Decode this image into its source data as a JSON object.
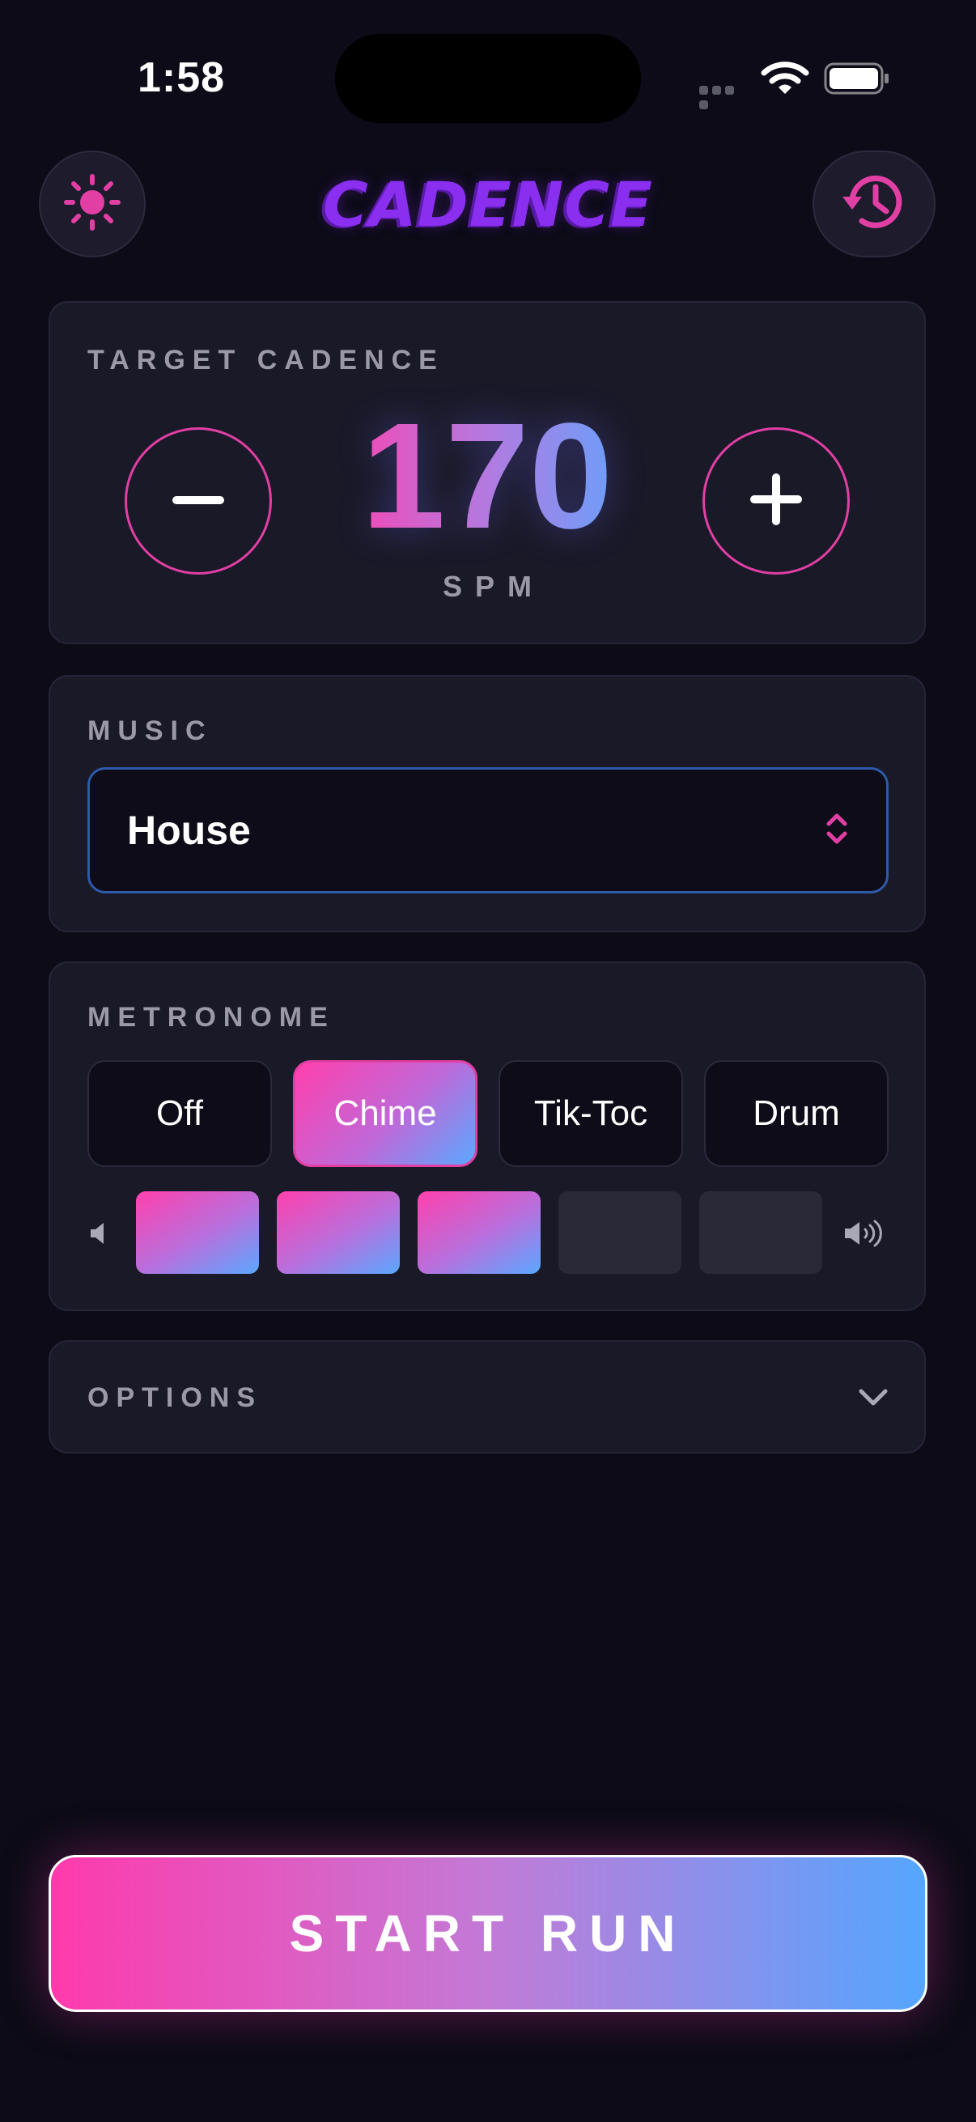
{
  "status_bar": {
    "time": "1:58"
  },
  "header": {
    "logo_text": "CADENCE",
    "theme_icon": "sun-icon",
    "history_icon": "history-icon"
  },
  "target_cadence": {
    "label": "TARGET CADENCE",
    "value": "170",
    "unit": "SPM",
    "decrement_icon": "minus-icon",
    "increment_icon": "plus-icon"
  },
  "music": {
    "label": "MUSIC",
    "selected": "House"
  },
  "metronome": {
    "label": "METRONOME",
    "options": [
      "Off",
      "Chime",
      "Tik-Toc",
      "Drum"
    ],
    "selected": "Chime",
    "volume_level": 3,
    "volume_max": 5
  },
  "options": {
    "label": "OPTIONS"
  },
  "start_button": {
    "label": "START RUN"
  },
  "colors": {
    "background": "#0c0b17",
    "card": "#1a1928",
    "accent_pink": "#ff40ad",
    "accent_blue": "#5aa8ff",
    "logo_purple": "#8a2ff0"
  }
}
